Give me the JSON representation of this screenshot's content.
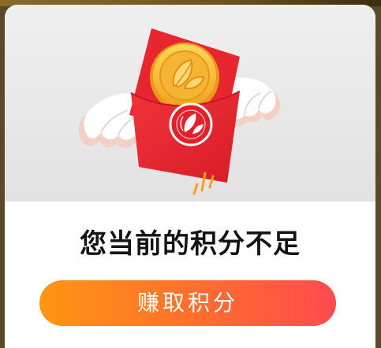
{
  "dialog": {
    "illustration_icon": "flying-red-envelope-coin-icon",
    "message": "您当前的积分不足",
    "cta_label": "赚取积分"
  },
  "colors": {
    "envelope_red": "#e8262f",
    "coin_gold": "#f7b532",
    "cta_start": "#ff9612",
    "cta_end": "#ff4a4e",
    "message_text": "#141414"
  }
}
